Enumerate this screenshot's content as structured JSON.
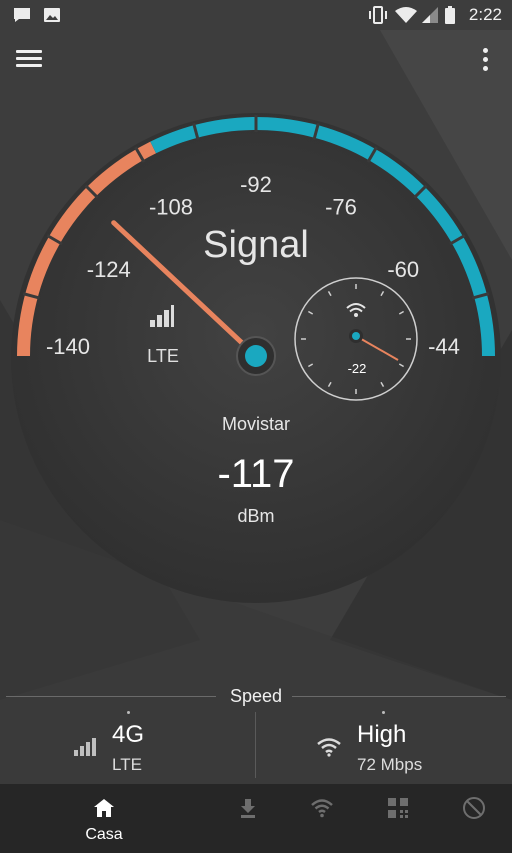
{
  "status_bar": {
    "time": "2:22"
  },
  "gauge": {
    "title": "Signal",
    "scale_labels": [
      "-140",
      "-124",
      "-108",
      "-92",
      "-76",
      "-60",
      "-44"
    ],
    "scale_min": -140,
    "scale_max": -44,
    "current_dbm": -117,
    "network_type": "LTE",
    "operator": "Movistar",
    "value": "-117",
    "unit": "dBm",
    "warm_color": "#e8845e",
    "cool_color": "#1aa8c0"
  },
  "wifi_gauge": {
    "value": "-22",
    "value_number": -22
  },
  "speed": {
    "title": "Speed",
    "left": {
      "main": "4G",
      "sub": "LTE",
      "icon": "signal-bars-icon"
    },
    "right": {
      "main": "High",
      "sub": "72 Mbps",
      "icon": "wifi-icon"
    }
  },
  "bottom_nav": {
    "active_label": "Casa",
    "items": [
      "home-icon",
      "download-icon",
      "wifi-icon",
      "qr-scan-icon",
      "no-ads-icon"
    ]
  }
}
